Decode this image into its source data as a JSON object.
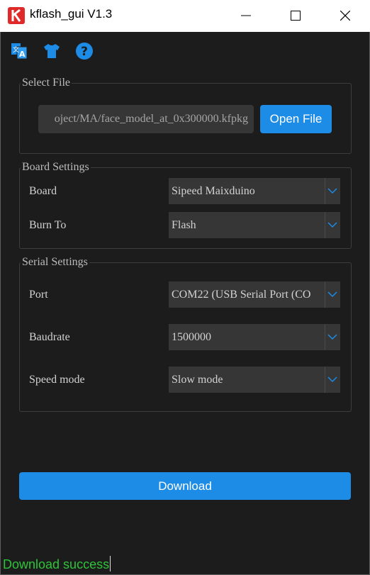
{
  "window": {
    "title": "kflash_gui V1.3",
    "logo_letter": "K",
    "colors": {
      "logo": "#e02a2a",
      "accent": "#1c8ce6",
      "status": "#2ec43a"
    }
  },
  "toolbar": {
    "icons": [
      "translate-icon",
      "shirt-icon",
      "help-icon"
    ],
    "help_glyph": "?"
  },
  "select_file": {
    "title": "Select File",
    "path": "oject/MA/face_model_at_0x300000.kfpkg",
    "open_label": "Open File"
  },
  "board_settings": {
    "title": "Board Settings",
    "board_label": "Board",
    "board_value": "Sipeed Maixduino",
    "burn_label": "Burn To",
    "burn_value": "Flash"
  },
  "serial_settings": {
    "title": "Serial Settings",
    "port_label": "Port",
    "port_value": "COM22 (USB Serial Port (CO",
    "baud_label": "Baudrate",
    "baud_value": "1500000",
    "speed_label": "Speed mode",
    "speed_value": "Slow mode"
  },
  "download": {
    "label": "Download"
  },
  "status": {
    "text": "Download success"
  }
}
